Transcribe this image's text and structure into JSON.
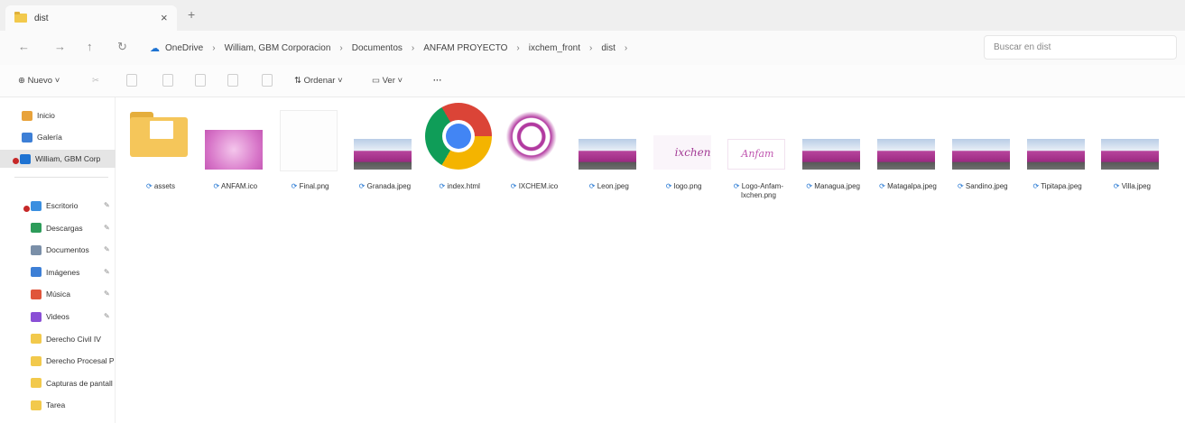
{
  "tab": {
    "title": "dist",
    "close": "×",
    "new": "+"
  },
  "nav": {
    "back": "←",
    "forward": "→",
    "up": "↑",
    "refresh": "↻"
  },
  "breadcrumb": [
    "OneDrive",
    "William, GBM Corporacion",
    "Documentos",
    "ANFAM PROYECTO",
    "ixchem_front",
    "dist"
  ],
  "breadcrumb_sep": "›",
  "search": {
    "placeholder": "Buscar en dist"
  },
  "toolbar": {
    "new_label": "Nuevo",
    "sort_label": "Ordenar",
    "view_label": "Ver",
    "more_label": "···"
  },
  "sidebar": {
    "top": [
      {
        "label": "Inicio",
        "icon": "home-icon"
      },
      {
        "label": "Galería",
        "icon": "gallery-icon"
      },
      {
        "label": "William, GBM Corp",
        "icon": "onedrive-icon"
      }
    ],
    "quick": [
      {
        "label": "Escritorio",
        "icon": "desktop-icon"
      },
      {
        "label": "Descargas",
        "icon": "download-icon"
      },
      {
        "label": "Documentos",
        "icon": "documents-icon"
      },
      {
        "label": "Imágenes",
        "icon": "pictures-icon"
      },
      {
        "label": "Música",
        "icon": "music-icon"
      },
      {
        "label": "Videos",
        "icon": "videos-icon"
      },
      {
        "label": "Derecho Civil IV",
        "icon": "folder-icon"
      },
      {
        "label": "Derecho Procesal P",
        "icon": "folder-icon"
      },
      {
        "label": "Capturas de pantall",
        "icon": "folder-icon"
      },
      {
        "label": "Tarea",
        "icon": "folder-icon"
      }
    ]
  },
  "files": [
    {
      "name": "assets",
      "kind": "folder"
    },
    {
      "name": "ANFAM.ico",
      "kind": "logo-pink"
    },
    {
      "name": "Final.png",
      "kind": "blank"
    },
    {
      "name": "Granada.jpeg",
      "kind": "photo"
    },
    {
      "name": "index.html",
      "kind": "chrome"
    },
    {
      "name": "IXCHEM.ico",
      "kind": "logo-big"
    },
    {
      "name": "Leon.jpeg",
      "kind": "photo"
    },
    {
      "name": "logo.png",
      "kind": "logo-text"
    },
    {
      "name": "Logo-Anfam-Ixchen.png",
      "kind": "logo-anfam"
    },
    {
      "name": "Managua.jpeg",
      "kind": "photo"
    },
    {
      "name": "Matagalpa.jpeg",
      "kind": "photo"
    },
    {
      "name": "Sandino.jpeg",
      "kind": "photo"
    },
    {
      "name": "Tipitapa.jpeg",
      "kind": "photo"
    },
    {
      "name": "Villa.jpeg",
      "kind": "photo"
    }
  ],
  "logo_text": {
    "ixchen": "ixchen",
    "anfam": "Anfam"
  },
  "colors": {
    "accent": "#1e73d2",
    "folder": "#f5c65a",
    "pink": "#b7449c"
  }
}
